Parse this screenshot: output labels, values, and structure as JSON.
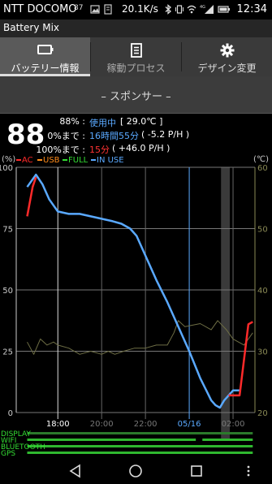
{
  "status_bar": {
    "carrier": "NTT DOCOMO",
    "small_number": "87",
    "speed": "20.1K/s",
    "time": "12:34"
  },
  "app": {
    "title": "Battery Mix"
  },
  "tabs": [
    {
      "label": "バッテリー情報",
      "icon": "battery-icon",
      "active": true
    },
    {
      "label": "稼動プロセス",
      "icon": "list-icon",
      "active": false
    },
    {
      "label": "デザイン変更",
      "icon": "gear-icon",
      "active": false
    }
  ],
  "sponsor": {
    "label": "– スポンサー –"
  },
  "battery": {
    "level": "88",
    "row1": {
      "prefix": "88% :",
      "status": "使用中",
      "temp": "[ 29.0℃ ]"
    },
    "row2": {
      "prefix": "0%まで :",
      "time": "16時間55分",
      "rate": "( -5.2 P/H )"
    },
    "row3": {
      "prefix": "100%まで :",
      "time": "15分",
      "rate": "( +46.0 P/H )"
    }
  },
  "legend": {
    "left_unit": "(%)",
    "right_unit": "(℃)",
    "items": [
      {
        "label": "AC",
        "color": "#ff2a2a"
      },
      {
        "label": "USB",
        "color": "#ff8c1a"
      },
      {
        "label": "FULL",
        "color": "#33dd33"
      },
      {
        "label": "IN USE",
        "color": "#5aa9ff"
      }
    ]
  },
  "chart_data": {
    "type": "line",
    "y_left_ticks": [
      "100",
      "75",
      "50",
      "25",
      "0"
    ],
    "y_right_ticks": [
      "60",
      "50",
      "40",
      "30",
      "20"
    ],
    "ylim_left": [
      0,
      100
    ],
    "ylim_right": [
      20,
      60
    ],
    "x_ticks": [
      {
        "label": "18:00",
        "h": 18,
        "color": "#ffffff"
      },
      {
        "label": "20:00",
        "h": 20,
        "color": "#777777"
      },
      {
        "label": "22:00",
        "h": 22,
        "color": "#777777"
      },
      {
        "label": "05/16",
        "h": 24,
        "color": "#5aa9ff"
      },
      {
        "label": "02:00",
        "h": 26,
        "color": "#777777"
      }
    ],
    "xlim": [
      16.1,
      27.0
    ],
    "in_use_pct": [
      [
        16.6,
        92
      ],
      [
        17.0,
        97
      ],
      [
        17.3,
        93
      ],
      [
        17.6,
        87
      ],
      [
        18.0,
        82
      ],
      [
        18.5,
        81
      ],
      [
        19.0,
        81
      ],
      [
        19.5,
        80
      ],
      [
        20.0,
        79
      ],
      [
        20.5,
        78
      ],
      [
        20.9,
        77
      ],
      [
        21.3,
        75
      ],
      [
        21.6,
        72
      ],
      [
        22.0,
        64
      ],
      [
        22.5,
        54
      ],
      [
        23.0,
        45
      ],
      [
        23.5,
        35
      ],
      [
        24.0,
        25
      ],
      [
        24.5,
        14
      ],
      [
        25.0,
        5
      ],
      [
        25.2,
        3
      ],
      [
        25.4,
        2
      ],
      [
        25.6,
        5
      ],
      [
        25.8,
        7
      ],
      [
        26.0,
        9
      ],
      [
        26.3,
        9
      ]
    ],
    "ac_pct": [
      [
        16.6,
        80
      ],
      [
        16.85,
        92
      ],
      [
        17.0,
        96
      ]
    ],
    "ac_pct_end": [
      [
        25.8,
        7
      ],
      [
        26.3,
        7
      ],
      [
        26.7,
        36
      ],
      [
        26.9,
        37
      ]
    ],
    "temp_c": [
      [
        16.6,
        31.5
      ],
      [
        16.9,
        29.5
      ],
      [
        17.2,
        32.0
      ],
      [
        17.5,
        31.0
      ],
      [
        17.8,
        31.5
      ],
      [
        18.0,
        31.0
      ],
      [
        18.5,
        30.5
      ],
      [
        19.0,
        29.5
      ],
      [
        19.5,
        30.0
      ],
      [
        20.0,
        29.5
      ],
      [
        20.3,
        30.0
      ],
      [
        20.6,
        29.5
      ],
      [
        21.0,
        30.0
      ],
      [
        21.5,
        30.5
      ],
      [
        22.0,
        30.5
      ],
      [
        22.5,
        31.0
      ],
      [
        23.0,
        31.0
      ],
      [
        23.3,
        33.0
      ],
      [
        23.5,
        35.0
      ],
      [
        23.8,
        34.0
      ],
      [
        24.5,
        34.5
      ],
      [
        25.0,
        33.5
      ],
      [
        25.3,
        35.0
      ],
      [
        25.7,
        33.5
      ],
      [
        26.0,
        32.0
      ],
      [
        26.5,
        31.0
      ],
      [
        26.9,
        33.0
      ]
    ],
    "charging_band_h": [
      25.45,
      25.85
    ],
    "bottom_rows": [
      {
        "label": "DISPLAY"
      },
      {
        "label": "WIFI"
      },
      {
        "label": "BLUETOOTH"
      },
      {
        "label": "GPS"
      }
    ]
  }
}
